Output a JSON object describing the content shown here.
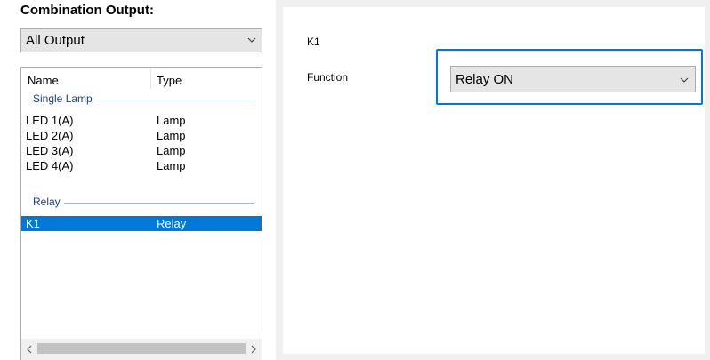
{
  "left": {
    "title": "Combination Output:",
    "output_select": {
      "value": "All Output"
    },
    "list": {
      "columns": [
        "Name",
        "Type"
      ],
      "groups": [
        {
          "label": "Single Lamp",
          "rows": [
            {
              "name": "LED 1(A)",
              "type": "Lamp"
            },
            {
              "name": "LED 2(A)",
              "type": "Lamp"
            },
            {
              "name": "LED 3(A)",
              "type": "Lamp"
            },
            {
              "name": "LED 4(A)",
              "type": "Lamp"
            }
          ]
        },
        {
          "label": "Relay",
          "rows": [
            {
              "name": "K1",
              "type": "Relay",
              "selected": true
            }
          ]
        }
      ]
    },
    "scrollbar": {
      "left_icon": "chevron-left-icon",
      "right_icon": "chevron-right-icon"
    }
  },
  "right": {
    "item_label": "K1",
    "function_label": "Function",
    "function_select": {
      "value": "Relay ON"
    }
  },
  "colors": {
    "selection": "#0078d7",
    "group_text": "#1e3c8c",
    "focus_frame": "#0078d7"
  },
  "icons": {
    "dropdown": "chevron-down-icon"
  }
}
